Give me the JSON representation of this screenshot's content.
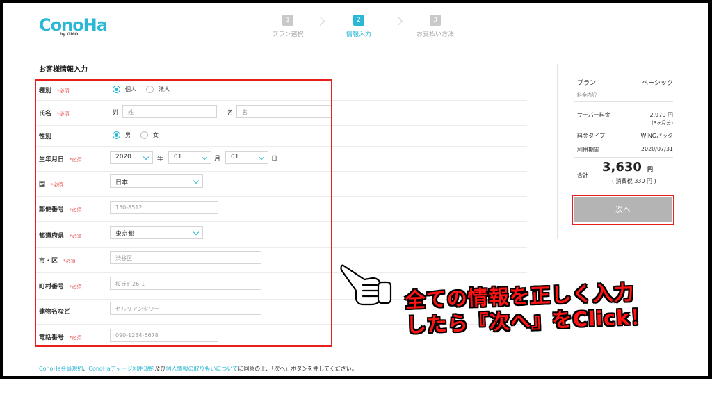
{
  "brand": {
    "logo": "ConoHa",
    "logo_sub": "by GMO"
  },
  "steps": [
    {
      "num": "1",
      "label": "プラン選択",
      "active": false
    },
    {
      "num": "2",
      "label": "情報入力",
      "active": true
    },
    {
      "num": "3",
      "label": "お支払い方法",
      "active": false
    }
  ],
  "form": {
    "title": "お客様情報入力",
    "required": "*必須",
    "type": {
      "label": "種別",
      "options": [
        "個人",
        "法人"
      ],
      "selected": "個人"
    },
    "name": {
      "label": "氏名",
      "last_label": "姓",
      "last_placeholder": "姓",
      "first_label": "名",
      "first_placeholder": "名"
    },
    "gender": {
      "label": "性別",
      "options": [
        "男",
        "女"
      ],
      "selected": "男"
    },
    "birth": {
      "label": "生年月日",
      "year": "2020",
      "year_unit": "年",
      "month": "01",
      "month_unit": "月",
      "day": "01",
      "day_unit": "日"
    },
    "country": {
      "label": "国",
      "value": "日本"
    },
    "postal": {
      "label": "郵便番号",
      "placeholder": "150-8512"
    },
    "prefecture": {
      "label": "都道府県",
      "value": "東京都"
    },
    "city": {
      "label": "市・区",
      "placeholder": "渋谷区"
    },
    "town": {
      "label": "町村番号",
      "placeholder": "桜丘町26-1"
    },
    "building": {
      "label": "建物名など",
      "placeholder": "セルリアンタワー"
    },
    "phone": {
      "label": "電話番号",
      "placeholder": "090-1234-5678"
    }
  },
  "footer": {
    "link1": "ConoHa会員規約",
    "sep1": "、",
    "link2": "ConoHaチャージ利用規約",
    "sep2": "及び",
    "link3": "個人情報の取り扱いについて",
    "text": "に同意の上、「次へ」ボタンを押してください。"
  },
  "summary": {
    "plan_label": "プラン",
    "plan_value": "ベーシック",
    "breakdown_label": "料金内訳",
    "server_label": "サーバー料金",
    "server_value": "2,970 円",
    "server_note": "(3ヶ月分)",
    "fee_type_label": "料金タイプ",
    "fee_type_value": "WINGパック",
    "period_label": "利用期間",
    "period_value": "2020/07/31",
    "total_label": "合計",
    "total_value": "3,630",
    "total_unit": "円",
    "tax": "( 消費税 330 円 )",
    "next_button": "次へ"
  },
  "annotation": {
    "line1": "全ての情報を正しく入力",
    "line2": "したら『次へ』をClick！"
  },
  "colors": {
    "accent": "#2bb7d6",
    "highlight": "#e8201c",
    "required": "#e84c4c",
    "button": "#b4b4b4"
  }
}
